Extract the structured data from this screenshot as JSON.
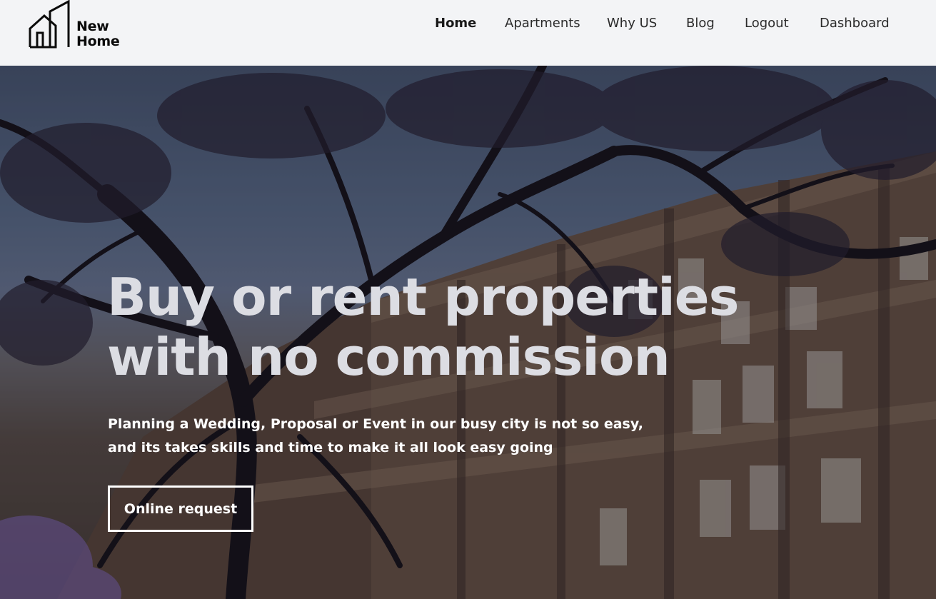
{
  "brand": {
    "line1": "New",
    "line2": "Home"
  },
  "nav": {
    "items": [
      {
        "label": "Home",
        "active": true
      },
      {
        "label": "Apartments",
        "active": false
      },
      {
        "label": "Why US",
        "active": false
      },
      {
        "label": "Blog",
        "active": false
      },
      {
        "label": "Logout",
        "active": false
      },
      {
        "label": "Dashboard",
        "active": false
      }
    ]
  },
  "hero": {
    "headline_line1": "Buy or rent properties",
    "headline_line2": "with no commission",
    "subtext_line1": "Planning a Wedding, Proposal or Event in our busy city is not so easy,",
    "subtext_line2": "and its takes skills and time to make it all look easy going",
    "cta_label": "Online request"
  },
  "colors": {
    "header_bg": "#f3f4f6",
    "nav_text": "#2b2b2b",
    "headline": "#dcdde3",
    "button_border": "#ffffff"
  },
  "icons": {
    "logo": "building-outline-icon"
  }
}
